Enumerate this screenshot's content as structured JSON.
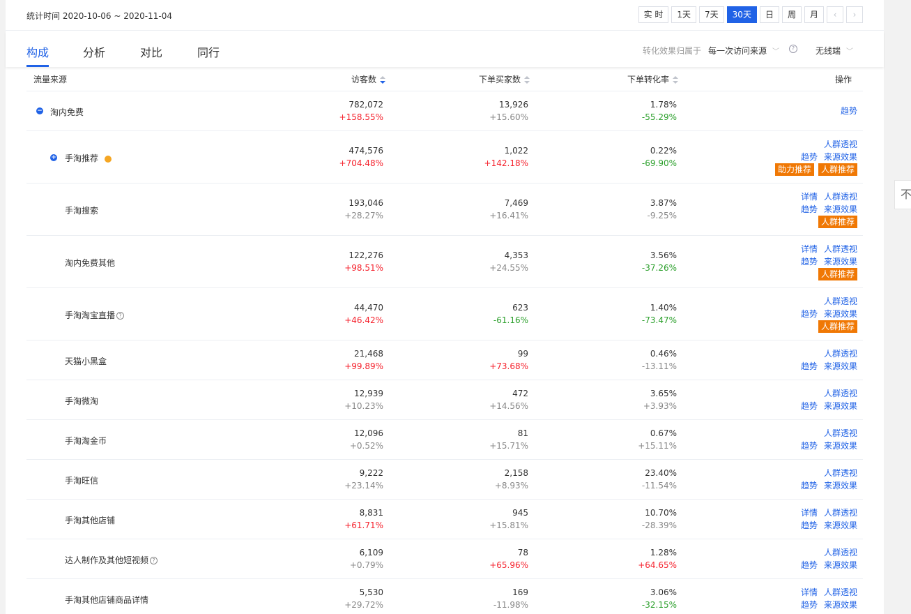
{
  "header": {
    "stat_time": "统计时间 2020-10-06 ~ 2020-11-04",
    "range_buttons": [
      "实 时",
      "1天",
      "7天",
      "30天",
      "日",
      "周",
      "月"
    ],
    "active_range": "30天",
    "prev_icon": "‹",
    "next_icon": "›"
  },
  "tabs": [
    "构成",
    "分析",
    "对比",
    "同行"
  ],
  "active_tab": "构成",
  "filters": {
    "attribution_label": "转化效果归属于",
    "attribution_value": "每一次访问来源",
    "device_value": "无线端"
  },
  "table": {
    "columns": [
      "流量来源",
      "访客数",
      "下单买家数",
      "下单转化率",
      "操作"
    ],
    "rows": [
      {
        "name": "淘内免费",
        "visitors": "782,072",
        "visitors_chg": "+158.55%",
        "buyers": "13,926",
        "buyers_chg": "+15.60%",
        "rate": "1.78%",
        "rate_chg": "-55.29%"
      },
      {
        "name": "手淘推荐",
        "visitors": "474,576",
        "visitors_chg": "+704.48%",
        "buyers": "1,022",
        "buyers_chg": "+142.18%",
        "rate": "0.22%",
        "rate_chg": "-69.90%"
      },
      {
        "name": "手淘搜索",
        "visitors": "193,046",
        "visitors_chg": "+28.27%",
        "buyers": "7,469",
        "buyers_chg": "+16.41%",
        "rate": "3.87%",
        "rate_chg": "-9.25%"
      },
      {
        "name": "淘内免费其他",
        "visitors": "122,276",
        "visitors_chg": "+98.51%",
        "buyers": "4,353",
        "buyers_chg": "+24.55%",
        "rate": "3.56%",
        "rate_chg": "-37.26%"
      },
      {
        "name": "手淘淘宝直播",
        "visitors": "44,470",
        "visitors_chg": "+46.42%",
        "buyers": "623",
        "buyers_chg": "-61.16%",
        "rate": "1.40%",
        "rate_chg": "-73.47%"
      },
      {
        "name": "天猫小黑盒",
        "visitors": "21,468",
        "visitors_chg": "+99.89%",
        "buyers": "99",
        "buyers_chg": "+73.68%",
        "rate": "0.46%",
        "rate_chg": "-13.11%"
      },
      {
        "name": "手淘微淘",
        "visitors": "12,939",
        "visitors_chg": "+10.23%",
        "buyers": "472",
        "buyers_chg": "+14.56%",
        "rate": "3.65%",
        "rate_chg": "+3.93%"
      },
      {
        "name": "手淘淘金币",
        "visitors": "12,096",
        "visitors_chg": "+0.52%",
        "buyers": "81",
        "buyers_chg": "+15.71%",
        "rate": "0.67%",
        "rate_chg": "+15.11%"
      },
      {
        "name": "手淘旺信",
        "visitors": "9,222",
        "visitors_chg": "+23.14%",
        "buyers": "2,158",
        "buyers_chg": "+8.93%",
        "rate": "23.40%",
        "rate_chg": "-11.54%"
      },
      {
        "name": "手淘其他店铺",
        "visitors": "8,831",
        "visitors_chg": "+61.71%",
        "buyers": "945",
        "buyers_chg": "+15.81%",
        "rate": "10.70%",
        "rate_chg": "-28.39%"
      },
      {
        "name": "达人制作及其他短视频",
        "visitors": "6,109",
        "visitors_chg": "+0.79%",
        "buyers": "78",
        "buyers_chg": "+65.96%",
        "rate": "1.28%",
        "rate_chg": "+64.65%"
      },
      {
        "name": "手淘其他店铺商品详情",
        "visitors": "5,530",
        "visitors_chg": "+29.72%",
        "buyers": "169",
        "buyers_chg": "-11.98%",
        "rate": "3.06%",
        "rate_chg": "-32.15%"
      }
    ]
  },
  "ops": {
    "trend": "趋势",
    "detail": "详情",
    "crowd_view": "人群透视",
    "source_effect": "来源效果",
    "boost_recommend": "助力推荐",
    "crowd_recommend": "人群推荐"
  },
  "icons": {
    "collapse": "−",
    "expand": "+",
    "help": "?",
    "back_to_top": "不"
  },
  "colors": {
    "accent": "#2062e6",
    "up": "#f5222d",
    "down": "#2ca02c",
    "tag": "#f07804",
    "status_dot": "#f5a623"
  }
}
